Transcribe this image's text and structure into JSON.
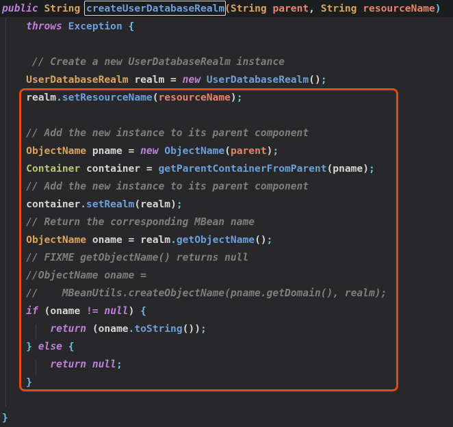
{
  "editor": {
    "background": "#28282a",
    "active_line_background": "#1c1d1f",
    "annotations": {
      "boxed_symbol": "createUserDatabaseRealm",
      "method_name_box_color": "#dcdcda",
      "highlight_box_color": "#e64a12"
    },
    "colors": {
      "kw": "#bd81d9",
      "op": "#bd81d9",
      "type": "#dba45c",
      "cls2": "#b8c775",
      "fn": "#6d9fdd",
      "param": "#e8826c",
      "plain": "#d6d6d6",
      "punct": "#6cc1dc",
      "comment": "#7e7e7e"
    },
    "lines": [
      {
        "tokens": [
          {
            "t": "public",
            "c": "kw"
          },
          {
            "t": " ",
            "c": "plain"
          },
          {
            "t": "String",
            "c": "type"
          },
          {
            "t": " ",
            "c": "plain"
          },
          {
            "t": "createUserDatabaseRealm",
            "c": "fn",
            "box": true
          },
          {
            "t": "(",
            "c": "type"
          },
          {
            "t": "String",
            "c": "type"
          },
          {
            "t": " ",
            "c": "plain"
          },
          {
            "t": "parent",
            "c": "param"
          },
          {
            "t": ", ",
            "c": "plain"
          },
          {
            "t": "String",
            "c": "type"
          },
          {
            "t": " ",
            "c": "plain"
          },
          {
            "t": "resourceName",
            "c": "param"
          },
          {
            "t": ")",
            "c": "punct"
          }
        ]
      },
      {
        "tokens": [
          {
            "t": "    ",
            "c": "plain"
          },
          {
            "t": "throws",
            "c": "kw"
          },
          {
            "t": " ",
            "c": "plain"
          },
          {
            "t": "Exception",
            "c": "fn"
          },
          {
            "t": " ",
            "c": "plain"
          },
          {
            "t": "{",
            "c": "punct"
          }
        ]
      },
      {
        "tokens": []
      },
      {
        "tokens": [
          {
            "t": "     // Create a new UserDatabaseRealm instance",
            "c": "comment"
          }
        ]
      },
      {
        "tokens": [
          {
            "t": "    ",
            "c": "plain"
          },
          {
            "t": "UserDatabaseRealm",
            "c": "type"
          },
          {
            "t": " realm ",
            "c": "plain"
          },
          {
            "t": "= ",
            "c": "plain"
          },
          {
            "t": "new",
            "c": "kw"
          },
          {
            "t": " ",
            "c": "plain"
          },
          {
            "t": "UserDatabaseRealm",
            "c": "fn"
          },
          {
            "t": "()",
            "c": "plain"
          },
          {
            "t": ";",
            "c": "punct"
          }
        ]
      },
      {
        "tokens": [
          {
            "t": "    ",
            "c": "plain"
          },
          {
            "t": "realm",
            "c": "plain"
          },
          {
            "t": ".",
            "c": "punct"
          },
          {
            "t": "setResourceName",
            "c": "fn"
          },
          {
            "t": "(",
            "c": "plain"
          },
          {
            "t": "resourceName",
            "c": "param"
          },
          {
            "t": ")",
            "c": "plain"
          },
          {
            "t": ";",
            "c": "punct"
          }
        ]
      },
      {
        "tokens": []
      },
      {
        "tokens": [
          {
            "t": "    // Add the new instance to its parent component",
            "c": "comment"
          }
        ]
      },
      {
        "tokens": [
          {
            "t": "    ",
            "c": "plain"
          },
          {
            "t": "ObjectName",
            "c": "type"
          },
          {
            "t": " pname ",
            "c": "plain"
          },
          {
            "t": "= ",
            "c": "plain"
          },
          {
            "t": "new",
            "c": "kw"
          },
          {
            "t": " ",
            "c": "plain"
          },
          {
            "t": "ObjectName",
            "c": "fn"
          },
          {
            "t": "(",
            "c": "plain"
          },
          {
            "t": "parent",
            "c": "param"
          },
          {
            "t": ")",
            "c": "plain"
          },
          {
            "t": ";",
            "c": "punct"
          }
        ]
      },
      {
        "tokens": [
          {
            "t": "    ",
            "c": "plain"
          },
          {
            "t": "Container",
            "c": "cls2"
          },
          {
            "t": " container ",
            "c": "plain"
          },
          {
            "t": "= ",
            "c": "plain"
          },
          {
            "t": "getParentContainerFromParent",
            "c": "fn"
          },
          {
            "t": "(",
            "c": "plain"
          },
          {
            "t": "pname",
            "c": "plain"
          },
          {
            "t": ")",
            "c": "plain"
          },
          {
            "t": ";",
            "c": "punct"
          }
        ]
      },
      {
        "tokens": [
          {
            "t": "    // Add the new instance to its parent component",
            "c": "comment"
          }
        ]
      },
      {
        "tokens": [
          {
            "t": "    ",
            "c": "plain"
          },
          {
            "t": "container",
            "c": "plain"
          },
          {
            "t": ".",
            "c": "punct"
          },
          {
            "t": "setRealm",
            "c": "fn"
          },
          {
            "t": "(",
            "c": "plain"
          },
          {
            "t": "realm",
            "c": "plain"
          },
          {
            "t": ")",
            "c": "plain"
          },
          {
            "t": ";",
            "c": "punct"
          }
        ]
      },
      {
        "tokens": [
          {
            "t": "    // Return the corresponding MBean name",
            "c": "comment"
          }
        ]
      },
      {
        "tokens": [
          {
            "t": "    ",
            "c": "plain"
          },
          {
            "t": "ObjectName",
            "c": "type"
          },
          {
            "t": " oname ",
            "c": "plain"
          },
          {
            "t": "= ",
            "c": "plain"
          },
          {
            "t": "realm",
            "c": "plain"
          },
          {
            "t": ".",
            "c": "punct"
          },
          {
            "t": "getObjectName",
            "c": "fn"
          },
          {
            "t": "()",
            "c": "plain"
          },
          {
            "t": ";",
            "c": "punct"
          }
        ]
      },
      {
        "tokens": [
          {
            "t": "    // FIXME getObjectName() returns null",
            "c": "comment"
          }
        ]
      },
      {
        "tokens": [
          {
            "t": "    //ObjectName oname =",
            "c": "comment"
          }
        ]
      },
      {
        "tokens": [
          {
            "t": "    //    MBeanUtils.createObjectName(pname.getDomain(), realm);",
            "c": "comment"
          }
        ]
      },
      {
        "tokens": [
          {
            "t": "    ",
            "c": "plain"
          },
          {
            "t": "if",
            "c": "kw"
          },
          {
            "t": " ",
            "c": "plain"
          },
          {
            "t": "(",
            "c": "plain"
          },
          {
            "t": "oname ",
            "c": "plain"
          },
          {
            "t": "!=",
            "c": "op"
          },
          {
            "t": " ",
            "c": "plain"
          },
          {
            "t": "null",
            "c": "kw"
          },
          {
            "t": ")",
            "c": "plain"
          },
          {
            "t": " ",
            "c": "plain"
          },
          {
            "t": "{",
            "c": "punct"
          }
        ]
      },
      {
        "tokens": [
          {
            "t": "        ",
            "c": "plain"
          },
          {
            "t": "return",
            "c": "kw"
          },
          {
            "t": " ",
            "c": "plain"
          },
          {
            "t": "(",
            "c": "plain"
          },
          {
            "t": "oname",
            "c": "plain"
          },
          {
            "t": ".",
            "c": "punct"
          },
          {
            "t": "toString",
            "c": "fn"
          },
          {
            "t": "())",
            "c": "plain"
          },
          {
            "t": ";",
            "c": "punct"
          }
        ]
      },
      {
        "tokens": [
          {
            "t": "    ",
            "c": "plain"
          },
          {
            "t": "}",
            "c": "punct"
          },
          {
            "t": " ",
            "c": "plain"
          },
          {
            "t": "else",
            "c": "kw"
          },
          {
            "t": " ",
            "c": "plain"
          },
          {
            "t": "{",
            "c": "punct"
          }
        ]
      },
      {
        "tokens": [
          {
            "t": "        ",
            "c": "plain"
          },
          {
            "t": "return",
            "c": "kw"
          },
          {
            "t": " ",
            "c": "plain"
          },
          {
            "t": "null",
            "c": "kw"
          },
          {
            "t": ";",
            "c": "punct"
          }
        ]
      },
      {
        "tokens": [
          {
            "t": "    ",
            "c": "plain"
          },
          {
            "t": "}",
            "c": "punct"
          }
        ]
      },
      {
        "tokens": []
      },
      {
        "tokens": [
          {
            "t": "}",
            "c": "punct"
          }
        ]
      }
    ]
  }
}
